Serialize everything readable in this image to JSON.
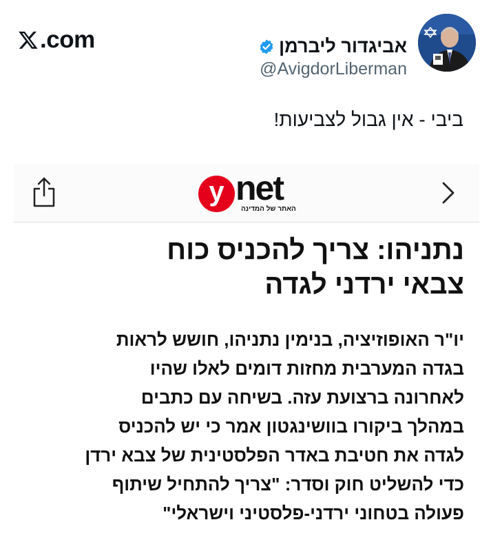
{
  "source": {
    "label": ".com"
  },
  "author": {
    "name": "אביגדור ליברמן",
    "handle": "@AvigdorLiberman"
  },
  "tweet": {
    "text": "ביבי - אין גבול לצביעות!"
  },
  "card": {
    "logo_y": "y",
    "logo_net": "net",
    "logo_tagline": "האתר של המדינה",
    "headline_lines": [
      "נתניהו: צריך להכניס כוח",
      "צבאי ירדני לגדה"
    ],
    "body_lines": [
      "יו\"ר האופוזיציה, בנימין נתניהו, חושש לראות",
      "בגדה המערבית מחזות דומים לאלו שהיו",
      "לאחרונה ברצועת עזה. בשיחה עם כתבים",
      "במהלך ביקורו בוושינגטון אמר כי יש להכניס",
      "לגדה את חטיבת באדר הפלסטינית של צבא ירדן",
      "כדי להשליט חוק וסדר: \"צריך להתחיל שיתוף",
      "פעולה בטחוני ירדני-פלסטיני וישראלי\""
    ]
  },
  "colors": {
    "ynet_red": "#e4001b",
    "verified_blue": "#1d9bf0",
    "handle_gray": "#536471"
  },
  "icons": {
    "x_logo": "x-logo-icon",
    "verified": "verified-badge-icon",
    "share": "share-icon",
    "back": "chevron-right-icon"
  }
}
